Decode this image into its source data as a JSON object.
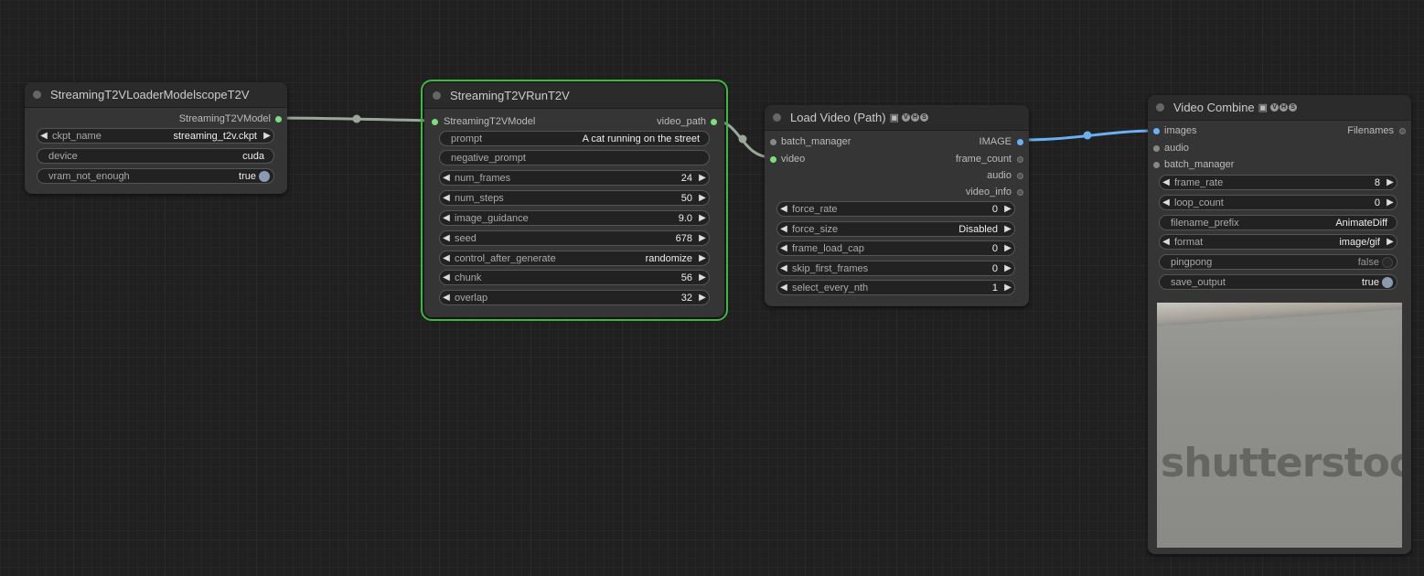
{
  "nodes": {
    "loader": {
      "title": "StreamingT2VLoaderModelscopeT2V",
      "output": "StreamingT2VModel",
      "widgets": [
        {
          "label": "ckpt_name",
          "value": "streaming_t2v.ckpt"
        },
        {
          "label": "device",
          "value": "cuda"
        },
        {
          "label": "vram_not_enough",
          "value": "true"
        }
      ]
    },
    "run": {
      "title": "StreamingT2VRunT2V",
      "input": "StreamingT2VModel",
      "output": "video_path",
      "widgets": [
        {
          "label": "prompt",
          "value": "A cat running on the street"
        },
        {
          "label": "negative_prompt",
          "value": ""
        },
        {
          "label": "num_frames",
          "value": "24"
        },
        {
          "label": "num_steps",
          "value": "50"
        },
        {
          "label": "image_guidance",
          "value": "9.0"
        },
        {
          "label": "seed",
          "value": "678"
        },
        {
          "label": "control_after_generate",
          "value": "randomize"
        },
        {
          "label": "chunk",
          "value": "56"
        },
        {
          "label": "overlap",
          "value": "32"
        }
      ]
    },
    "load": {
      "title": "Load Video (Path)",
      "inputs": [
        "batch_manager",
        "video"
      ],
      "outputs": [
        "IMAGE",
        "frame_count",
        "audio",
        "video_info"
      ],
      "widgets": [
        {
          "label": "force_rate",
          "value": "0"
        },
        {
          "label": "force_size",
          "value": "Disabled"
        },
        {
          "label": "frame_load_cap",
          "value": "0"
        },
        {
          "label": "skip_first_frames",
          "value": "0"
        },
        {
          "label": "select_every_nth",
          "value": "1"
        }
      ]
    },
    "combine": {
      "title": "Video Combine",
      "inputs": [
        "images",
        "audio",
        "batch_manager"
      ],
      "output": "Filenames",
      "widgets": [
        {
          "label": "frame_rate",
          "value": "8"
        },
        {
          "label": "loop_count",
          "value": "0"
        },
        {
          "label": "filename_prefix",
          "value": "AnimateDiff"
        },
        {
          "label": "format",
          "value": "image/gif"
        },
        {
          "label": "pingpong",
          "value": "false"
        },
        {
          "label": "save_output",
          "value": "true"
        }
      ],
      "preview_watermark": "shutterstock"
    }
  },
  "badge_letters": [
    "V",
    "H",
    "S"
  ],
  "icons": {
    "camera": "camera-icon",
    "arrow_left": "◀",
    "arrow_right": "▶"
  },
  "colors": {
    "link_model": "#9aa89a",
    "link_image": "#6ab0f2",
    "selected_outline": "#3cb93c",
    "slot_green": "#7be07b"
  }
}
